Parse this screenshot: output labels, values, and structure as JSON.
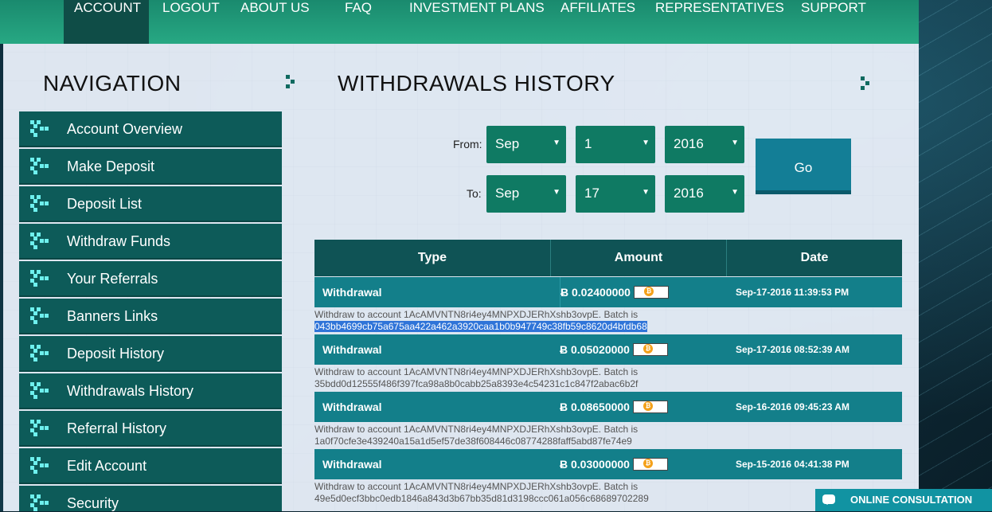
{
  "topnav": {
    "items": [
      {
        "label": "ACCOUNT"
      },
      {
        "label": "LOGOUT"
      },
      {
        "label": "ABOUT US"
      },
      {
        "label": "FAQ"
      },
      {
        "label": "INVESTMENT PLANS"
      },
      {
        "label": "AFFILIATES"
      },
      {
        "label": "REPRESENTATIVES"
      },
      {
        "label": "SUPPORT"
      }
    ]
  },
  "sidebar": {
    "title": "NAVIGATION",
    "items": [
      {
        "label": "Account Overview"
      },
      {
        "label": "Make Deposit"
      },
      {
        "label": "Deposit List"
      },
      {
        "label": "Withdraw Funds"
      },
      {
        "label": "Your Referrals"
      },
      {
        "label": "Banners Links"
      },
      {
        "label": "Deposit History"
      },
      {
        "label": "Withdrawals History"
      },
      {
        "label": "Referral History"
      },
      {
        "label": "Edit Account"
      },
      {
        "label": "Security"
      }
    ]
  },
  "main": {
    "title": "WITHDRAWALS HISTORY",
    "filter": {
      "from_label": "From:",
      "to_label": "To:",
      "from": {
        "month": "Sep",
        "day": "1",
        "year": "2016"
      },
      "to": {
        "month": "Sep",
        "day": "17",
        "year": "2016"
      },
      "go_label": "Go"
    },
    "table": {
      "headers": [
        "Type",
        "Amount",
        "Date"
      ],
      "rows": [
        {
          "type": "Withdrawal",
          "amount": "Ƀ 0.02400000",
          "date": "Sep-17-2016 11:39:53 PM",
          "desc": "Withdraw to account 1AcAMVNTN8ri4ey4MNPXDJERhXshb3ovpE. Batch is",
          "batch": "043bb4699cb75a675aa422a462a3920caa1b0b947749c38fb59c8620d4bfdb68"
        },
        {
          "type": "Withdrawal",
          "amount": "Ƀ 0.05020000",
          "date": "Sep-17-2016 08:52:39 AM",
          "desc": "Withdraw to account 1AcAMVNTN8ri4ey4MNPXDJERhXshb3ovpE. Batch is",
          "batch": "35bdd0d12555f486f397fca98a8b0cabb25a8393e4c54231c1c847f2abac6b2f"
        },
        {
          "type": "Withdrawal",
          "amount": "Ƀ 0.08650000",
          "date": "Sep-16-2016 09:45:23 AM",
          "desc": "Withdraw to account 1AcAMVNTN8ri4ey4MNPXDJERhXshb3ovpE. Batch is",
          "batch": "1a0f70cfe3e439240a15a1d5ef57de38f608446c08774288faff5abd87fe74e9"
        },
        {
          "type": "Withdrawal",
          "amount": "Ƀ 0.03000000",
          "date": "Sep-15-2016 04:41:38 PM",
          "desc": "Withdraw to account 1AcAMVNTN8ri4ey4MNPXDJERhXshb3ovpE. Batch is",
          "batch": "49e5d0ecf3bbc0edb1846a843d3b67bb35d81d3198ccc061a056c68689702289"
        }
      ]
    }
  },
  "consult": {
    "label": "ONLINE CONSULTATION"
  },
  "colors": {
    "accent": "#0d5b59",
    "table_row": "#137f8a",
    "nav": "#27a883",
    "coin": "#f4a11a"
  }
}
